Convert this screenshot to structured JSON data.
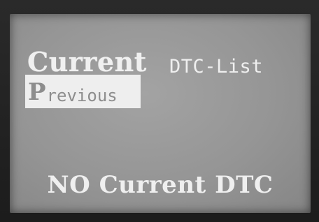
{
  "screen": {
    "heading_primary": "Current",
    "heading_secondary": "DTC-List",
    "menu_selected_initial": "P",
    "menu_selected_rest": "revious",
    "status_message": "NO Current DTC"
  }
}
